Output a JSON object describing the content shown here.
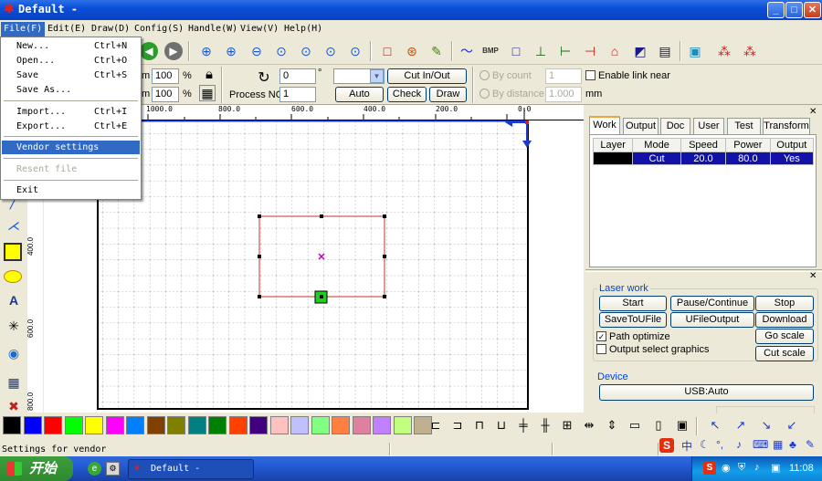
{
  "window": {
    "title": "Default -",
    "icon": "app-logo-icon"
  },
  "window_controls": {
    "minimize": "_",
    "maximize": "□",
    "close": "✕"
  },
  "menubar": [
    "File(F)",
    "Edit(E)",
    "Draw(D)",
    "Config(S)",
    "Handle(W)",
    "View(V)",
    "Help(H)"
  ],
  "file_menu": {
    "items": [
      {
        "label": "New...",
        "shortcut": "Ctrl+N"
      },
      {
        "label": "Open...",
        "shortcut": "Ctrl+O"
      },
      {
        "label": "Save",
        "shortcut": "Ctrl+S"
      },
      {
        "label": "Save As...",
        "shortcut": ""
      },
      {
        "label": "Import...",
        "shortcut": "Ctrl+I"
      },
      {
        "label": "Export...",
        "shortcut": "Ctrl+E"
      },
      {
        "label": "Vendor settings",
        "shortcut": ""
      },
      {
        "label": "Resent file",
        "shortcut": ""
      },
      {
        "label": "Exit",
        "shortcut": ""
      }
    ]
  },
  "toolbar2": {
    "size_x_unit": "m",
    "size_y_unit": "m",
    "scale_x": "100",
    "scale_y": "100",
    "percent": "%",
    "angle": "0",
    "degree": "°",
    "process_no_label": "Process NO:",
    "process_no": "1",
    "cut_in_out": "Cut In/Out",
    "auto": "Auto",
    "check": "Check",
    "draw": "Draw",
    "by_count_label": "By count",
    "by_count_value": "1",
    "by_distance_label": "By distance",
    "by_distance_value": "1.000",
    "distance_unit": "mm",
    "enable_link_near": "Enable link near"
  },
  "ruler": {
    "h_labels": [
      "1000.0",
      "800.0",
      "600.0",
      "400.0",
      "200.0",
      "0.0"
    ],
    "v_labels": [
      "400.0",
      "600.0",
      "800.0"
    ]
  },
  "right_panel": {
    "tabs": [
      "Work",
      "Output",
      "Doc",
      "User",
      "Test",
      "Transform"
    ],
    "layer_table": {
      "headers": [
        "Layer",
        "Mode",
        "Speed",
        "Power",
        "Output"
      ],
      "rows": [
        {
          "mode": "Cut",
          "speed": "20.0",
          "power": "80.0",
          "output": "Yes",
          "color": "#000000"
        }
      ]
    },
    "laser_work": {
      "title": "Laser work",
      "start": "Start",
      "pause": "Pause/Continue",
      "stop": "Stop",
      "save_to_ufile": "SaveToUFile",
      "ufile_output": "UFileOutput",
      "download": "Download",
      "path_optimize": "Path optimize",
      "output_select": "Output select graphics",
      "go_scale": "Go scale",
      "cut_scale": "Cut scale"
    },
    "device": {
      "title": "Device",
      "value": "USB:Auto"
    }
  },
  "palette": [
    "#000000",
    "#0000ff",
    "#ff0000",
    "#00ff00",
    "#ffff00",
    "#ff00ff",
    "#0080ff",
    "#804000",
    "#808000",
    "#008080",
    "#008000",
    "#ff4000",
    "#400080",
    "#ffc0c0",
    "#c0c0ff",
    "#80ff80",
    "#ff8040",
    "#e080a0",
    "#c080ff",
    "#c0ff80",
    "#c0b090"
  ],
  "status_text": "Settings for vendor",
  "taskbar": {
    "start": "开始",
    "task": "Default -",
    "time": "11:08"
  }
}
